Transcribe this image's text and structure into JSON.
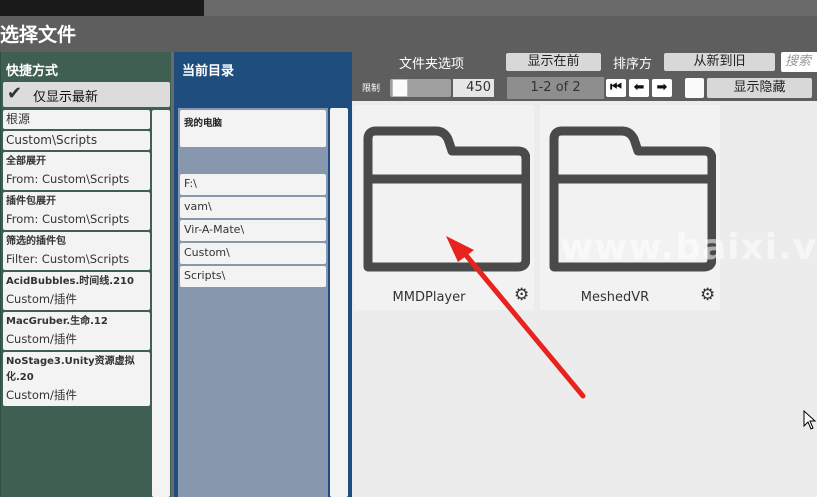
{
  "window": {
    "title": "选择文件"
  },
  "shortcuts": {
    "title": "快捷方式",
    "toggle_label": "仅显示最新",
    "items": [
      {
        "line1": "根源"
      },
      {
        "line1": "Custom\\Scripts"
      },
      {
        "line1": "全部展开",
        "line2": "From: Custom\\Scripts"
      },
      {
        "line1": "插件包展开",
        "line2": "From: Custom\\Scripts"
      },
      {
        "line1": "筛选的插件包",
        "line2": "Filter: Custom\\Scripts"
      },
      {
        "line1": "AcidBubbles.时间线.210",
        "line2": "Custom/插件"
      },
      {
        "line1": "MacGruber.生命.12",
        "line2": "Custom/插件"
      },
      {
        "line1": "NoStage3.Unity资源虚拟化.20",
        "line2": "Custom/插件"
      }
    ]
  },
  "current_dir": {
    "title": "当前目录",
    "root_label": "我的电脑",
    "paths": [
      "F:\\",
      "vam\\",
      "Vir-A-Mate\\",
      "Custom\\",
      "Scripts\\"
    ]
  },
  "toolbar": {
    "folder_options_label": "文件夹选项",
    "show_first_button": "显示在前",
    "sort_label": "排序方",
    "sort_button": "从新到旧",
    "search_placeholder": "搜索",
    "limit_label": "限制",
    "limit_value": "450",
    "page_info": "1-2 of 2",
    "nav_first_icon": "⏮",
    "nav_prev_icon": "⬅",
    "nav_next_icon": "➡",
    "show_hidden_label": "显示隐藏"
  },
  "files": [
    {
      "name": "MMDPlayer"
    },
    {
      "name": "MeshedVR"
    }
  ],
  "watermark": "www.baixi.vip",
  "colors": {
    "accent_blue": "#1f4d7d",
    "shortcut_green": "#3f5f52",
    "arrow_red": "#e8231f"
  }
}
